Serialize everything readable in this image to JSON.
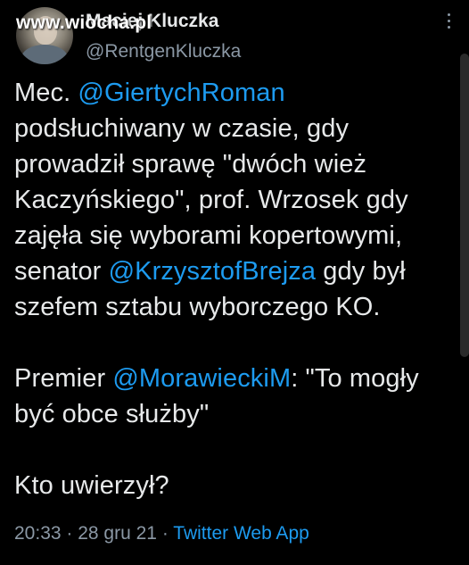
{
  "watermark": "www.wiocha.pl",
  "author": {
    "display_name": "Maciej Kluczka",
    "handle": "@RentgenKluczka"
  },
  "tweet": {
    "p1": {
      "t1": "Mec. ",
      "m1": "@GiertychRoman",
      "t2": " podsłuchiwany w czasie, gdy prowadził sprawę \"dwóch wież Kaczyńskiego\", prof. Wrzosek gdy zajęła się wyborami kopertowymi, senator ",
      "m2": "@KrzysztofBrejza",
      "t3": " gdy był szefem sztabu wyborczego KO."
    },
    "p2": {
      "t1": "Premier ",
      "m1": "@MorawieckiM",
      "t2": ": \"To mogły być obce służby\""
    },
    "p3": "Kto uwierzył?"
  },
  "meta": {
    "time": "20:33",
    "sep1": " · ",
    "date": "28 gru 21",
    "sep2": " · ",
    "app": "Twitter Web App"
  },
  "icons": {
    "more": "more-vertical-icon"
  },
  "colors": {
    "background": "#000000",
    "text": "#e7e9ea",
    "secondary": "#8b98a5",
    "link": "#1d9bf0"
  }
}
